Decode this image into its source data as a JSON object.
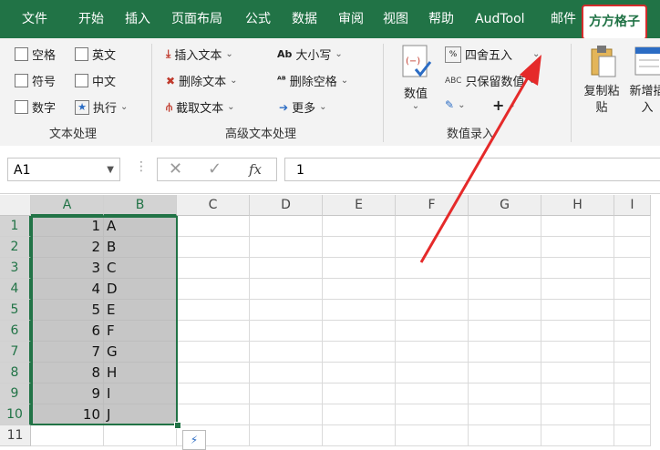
{
  "tabs": [
    "文件",
    "开始",
    "插入",
    "页面布局",
    "公式",
    "数据",
    "审阅",
    "视图",
    "帮助",
    "AudTool",
    "邮件",
    "方方格子"
  ],
  "ribbon": {
    "text_group": {
      "items": [
        "空格",
        "英文",
        "符号",
        "中文",
        "数字",
        "执行"
      ],
      "label": "文本处理"
    },
    "adv_group": {
      "items": [
        "插入文本",
        "删除文本",
        "截取文本",
        "大小写",
        "删除空格",
        "更多"
      ],
      "label": "高级文本处理"
    },
    "num_group": {
      "big_label": "数值",
      "items": [
        "四舍五入",
        "只保留数值",
        "+"
      ],
      "label": "数值录入"
    },
    "copy_btn": "复制粘\n贴",
    "new_btn": "新增插\n入"
  },
  "formula": {
    "namebox": "A1",
    "fx": "fx",
    "value": "1"
  },
  "sheet": {
    "columns": [
      "A",
      "B",
      "C",
      "D",
      "E",
      "F",
      "G",
      "H",
      "I"
    ],
    "rows": [
      "1",
      "2",
      "3",
      "4",
      "5",
      "6",
      "7",
      "8",
      "9",
      "10",
      "11"
    ],
    "col_a": [
      "1",
      "2",
      "3",
      "4",
      "5",
      "6",
      "7",
      "8",
      "9",
      "10"
    ],
    "col_b": [
      "A",
      "B",
      "C",
      "D",
      "E",
      "F",
      "G",
      "H",
      "I",
      "J"
    ]
  },
  "colors": {
    "brand": "#217346",
    "highlight": "#d42c2c"
  }
}
